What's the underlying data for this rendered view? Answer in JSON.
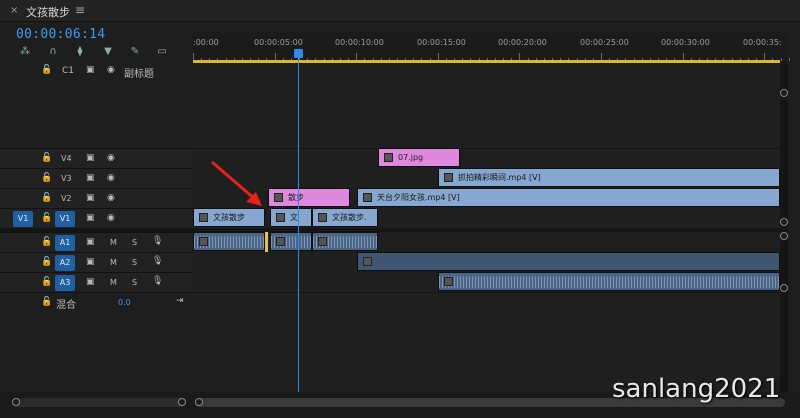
{
  "tab": {
    "close": "×",
    "title": "文孩散步",
    "menu": "≡"
  },
  "timecode": "00:00:06:14",
  "tools": [
    "snap-icon",
    "magnet-icon",
    "linked-selection-icon",
    "marker-icon",
    "wrench-icon",
    "captions-icon"
  ],
  "ruler_labels": [
    ":00:00",
    "00:00:05:00",
    "00:00:10:00",
    "00:00:15:00",
    "00:00:20:00",
    "00:00:25:00",
    "00:00:30:00",
    "00:00:35:"
  ],
  "caption_track": {
    "lock": "🔓",
    "id": "C1",
    "label": "副标题"
  },
  "video_tracks": [
    {
      "id": "V4",
      "src": ""
    },
    {
      "id": "V3",
      "src": ""
    },
    {
      "id": "V2",
      "src": ""
    },
    {
      "id": "V1",
      "src": "V1"
    }
  ],
  "audio_tracks": [
    {
      "id": "A1",
      "m": "M",
      "s": "S"
    },
    {
      "id": "A2",
      "m": "M",
      "s": "S"
    },
    {
      "id": "A3",
      "m": "M",
      "s": "S"
    }
  ],
  "mix": {
    "label": "混合",
    "value": "0.0"
  },
  "clips": {
    "v4": {
      "label": "07.jpg"
    },
    "v3": {
      "label": "抓拍精彩瞬间.mp4 [V]"
    },
    "v2a": {
      "label": "散步"
    },
    "v2b": {
      "label": "天台夕阳女孩.mp4 [V]"
    },
    "v1a": {
      "label": "文孩散步"
    },
    "v1b": {
      "label": "文"
    },
    "v1c": {
      "label": "文孩散步."
    }
  },
  "watermark": "sanlang2021"
}
